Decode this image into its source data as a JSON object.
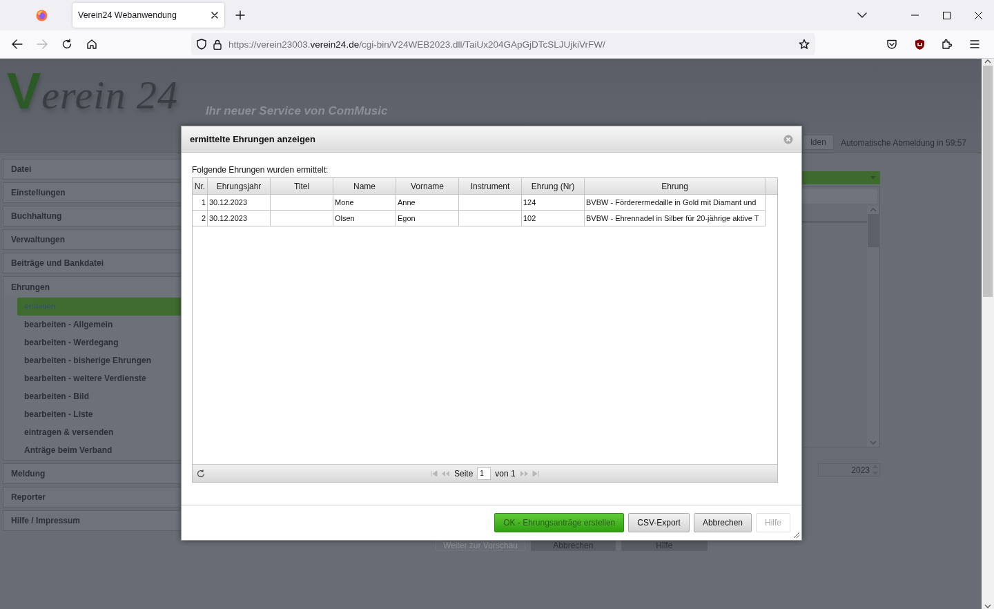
{
  "browser": {
    "tab_title": "Verein24 Webanwendung",
    "url_parts": [
      "https://verein23003.",
      "verein24.de",
      "/cgi-bin/V24WEB2023.dll/TaiUx204GApGjDTcSLJUjkiVrFW/"
    ]
  },
  "page": {
    "logo": {
      "initial": "V",
      "text": "erein 24"
    },
    "tagline": "Ihr neuer Service von ComMusic",
    "logout_button": "lden",
    "auto_logout": "Automatische Abmeldung in 59:57"
  },
  "sidebar": [
    {
      "label": "Datei",
      "expanded": false
    },
    {
      "label": "Einstellungen",
      "expanded": false
    },
    {
      "label": "Buchhaltung",
      "expanded": false
    },
    {
      "label": "Verwaltungen",
      "expanded": false
    },
    {
      "label": "Beiträge und Bankdatei",
      "expanded": false
    },
    {
      "label": "Ehrungen",
      "expanded": true,
      "children": [
        {
          "label": "erstellen",
          "selected": true
        },
        {
          "label": "bearbeiten - Allgemein",
          "selected": false
        },
        {
          "label": "bearbeiten - Werdegang",
          "selected": false
        },
        {
          "label": "bearbeiten - bisherige Ehrungen",
          "selected": false
        },
        {
          "label": "bearbeiten - weitere Verdienste",
          "selected": false
        },
        {
          "label": "bearbeiten - Bild",
          "selected": false
        },
        {
          "label": "bearbeiten - Liste",
          "selected": false
        },
        {
          "label": "eintragen & versenden",
          "selected": false
        },
        {
          "label": "Anträge beim Verband",
          "selected": false
        }
      ]
    },
    {
      "label": "Meldung",
      "expanded": false
    },
    {
      "label": "Reporter",
      "expanded": false
    },
    {
      "label": "Hilfe / Impressum",
      "expanded": false
    }
  ],
  "content": {
    "year": "2023",
    "buttons": [
      {
        "label": "Weiter zur Vorschau",
        "disabled": true
      },
      {
        "label": "Abbrechen",
        "disabled": false
      },
      {
        "label": "Hilfe",
        "disabled": false
      }
    ]
  },
  "dialog": {
    "title": "ermittelte Ehrungen anzeigen",
    "intro": "Folgende Ehrungen wurden ermittelt:",
    "columns": [
      "Nr.",
      "Ehrungsjahr",
      "Titel",
      "Name",
      "Vorname",
      "Instrument",
      "Ehrung (Nr)",
      "Ehrung"
    ],
    "rows": [
      {
        "nr": "1",
        "year": "30.12.2023",
        "name": "Mone",
        "first_name": "Anne",
        "honor_nr": "124",
        "honor": "BVBW - Förderermedaille in Gold mit Diamant und"
      },
      {
        "nr": "2",
        "year": "30.12.2023",
        "name": "Olsen",
        "first_name": "Egon",
        "honor_nr": "102",
        "honor": "BVBW - Ehrennadel in Silber für 20-jährige aktive T"
      }
    ],
    "pager": {
      "page_label": "Seite",
      "page": "1",
      "of": "von 1"
    },
    "buttons": [
      {
        "label": "OK - Ehrungsanträge erstellen",
        "kind": "primary",
        "disabled": false
      },
      {
        "label": "CSV-Export",
        "kind": "default",
        "disabled": false
      },
      {
        "label": "Abbrechen",
        "kind": "default",
        "disabled": false
      },
      {
        "label": "Hilfe",
        "kind": "default",
        "disabled": true
      }
    ]
  }
}
